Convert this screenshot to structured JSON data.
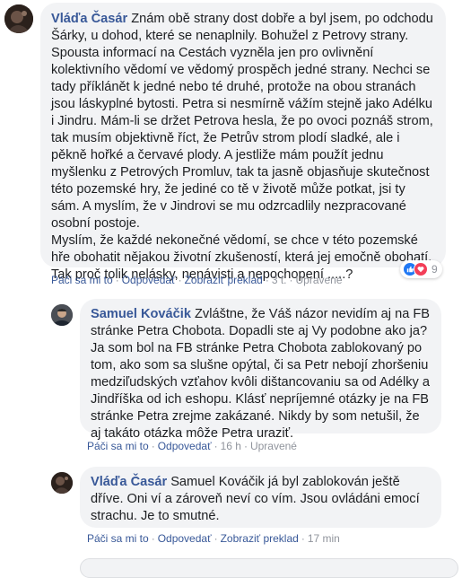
{
  "comments": [
    {
      "author": "Vláďa Časár",
      "text": "Znám obě strany dost dobře a byl jsem, po odchodu Šárky, u dohod, které se nenaplnily. Bohužel z Petrovy strany. Spousta informací na Cestách vyzněla jen pro ovlivnění kolektivního vědomí ve vědomý prospěch jedné strany. Nechci se tady příklánět k jedné nebo té druhé, protože na obou stranách jsou láskyplné bytosti. Petra si nesmírně vážím stejně jako Adélku i Jindru. Mám-li se držet Petrova hesla, že po ovoci poznáš strom, tak musím objektivně říct, že Petrův strom plodí sladké, ale i pěkně hořké a červavé plody. A jestliže mám použít jednu myšlenku z Petrových Promluv, tak ta jasně objasňuje skutečnost této pozemské hry, že jediné co tě v životě může potkat, jsi ty sám. A myslím, že v Jindrovi se mu odzrcadlily nezpracované osobní postoje.\nMyslím, že každé nekonečné vědomí, se chce v této pozemské hře obohatit nějakou životní zkušeností, která jej emočně obohatí. Tak proč tolik nelásky, nenávisti a nepochopení .....?",
      "actions": {
        "like": "Páči sa mi to",
        "reply": "Odpovedať",
        "translate": "Zobraziť preklad",
        "time": "3 t.",
        "edited": "Upravené"
      },
      "reactions": {
        "count": "9",
        "icons": [
          "like-icon",
          "love-icon"
        ]
      }
    },
    {
      "author": "Samuel Kováčik",
      "text": "Zvláštne, že Váš názor nevidím aj na FB stránke Petra Chobota. Dopadli ste aj Vy podobne ako ja? Ja som bol na FB stránke Petra Chobota zablokovaný po tom, ako som sa slušne opýtal, či sa Petr nebojí zhoršeniu medziľudských vzťahov kvôli dištancovaniu sa od Adélky a Jindříška od ich eshopu. Klásť nepríjemné otázky je na FB stránke Petra zrejme zakázané. Nikdy by som netušil, že aj takáto otázka môže Petra uraziť.",
      "actions": {
        "like": "Páči sa mi to",
        "reply": "Odpovedať",
        "time": "16 h",
        "edited": "Upravené"
      }
    },
    {
      "author": "Vláďa Časár",
      "text": "Samuel Kováčik já byl zablokován ještě dříve. Oni ví a zároveň neví co vím. Jsou ovládáni emocí strachu. Je to smutné.",
      "actions": {
        "like": "Páči sa mi to",
        "reply": "Odpovedať",
        "translate": "Zobraziť preklad",
        "time": "17 min"
      }
    }
  ],
  "colors": {
    "link": "#385898",
    "bubble": "#f2f3f5",
    "meta": "#90949c",
    "like": "#2078f4",
    "love": "#f33e58"
  }
}
